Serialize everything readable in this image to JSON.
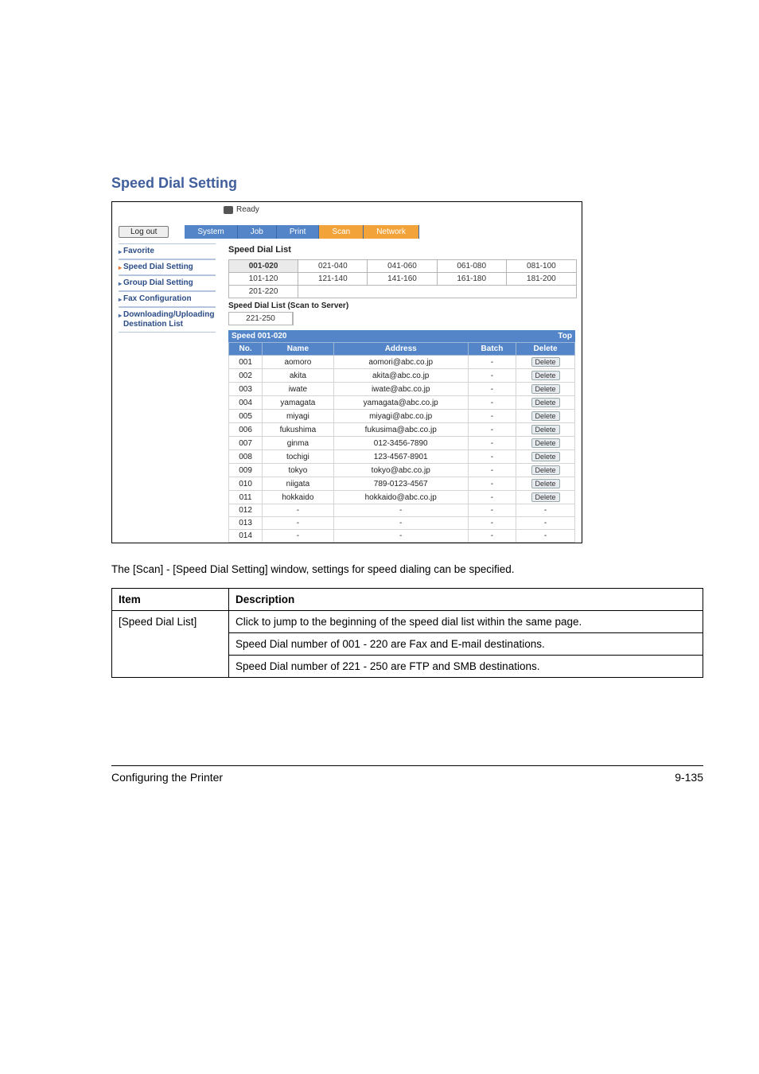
{
  "section_heading": "Speed Dial Setting",
  "screenshot": {
    "ready_status": "Ready",
    "logout_label": "Log out",
    "tabs": {
      "system": "System",
      "job": "Job",
      "print": "Print",
      "scan": "Scan",
      "network": "Network"
    },
    "sidebar": {
      "favorite": "Favorite",
      "speed_dial_setting": "Speed Dial Setting",
      "group_dial_setting": "Group Dial Setting",
      "fax_configuration": "Fax Configuration",
      "download_upload": "Downloading/Uploading Destination List"
    },
    "pane": {
      "title": "Speed Dial List",
      "range_tabs": [
        "001-020",
        "021-040",
        "041-060",
        "061-080",
        "081-100",
        "101-120",
        "121-140",
        "141-160",
        "161-180",
        "181-200",
        "201-220"
      ],
      "subtitle": "Speed Dial List (Scan to Server)",
      "range_tabs2": [
        "221-250"
      ],
      "header_left": "Speed 001-020",
      "header_right": "Top",
      "col_no": "No.",
      "col_name": "Name",
      "col_address": "Address",
      "col_batch": "Batch",
      "col_delete": "Delete",
      "delete_btn": "Delete",
      "rows": [
        {
          "no": "001",
          "name": "aomoro",
          "address": "aomori@abc.co.jp",
          "batch": "-",
          "del": true
        },
        {
          "no": "002",
          "name": "akita",
          "address": "akita@abc.co.jp",
          "batch": "-",
          "del": true
        },
        {
          "no": "003",
          "name": "iwate",
          "address": "iwate@abc.co.jp",
          "batch": "-",
          "del": true
        },
        {
          "no": "004",
          "name": "yamagata",
          "address": "yamagata@abc.co.jp",
          "batch": "-",
          "del": true
        },
        {
          "no": "005",
          "name": "miyagi",
          "address": "miyagi@abc.co.jp",
          "batch": "-",
          "del": true
        },
        {
          "no": "006",
          "name": "fukushima",
          "address": "fukusima@abc.co.jp",
          "batch": "-",
          "del": true
        },
        {
          "no": "007",
          "name": "ginma",
          "address": "012-3456-7890",
          "batch": "-",
          "del": true
        },
        {
          "no": "008",
          "name": "tochigi",
          "address": "123-4567-8901",
          "batch": "-",
          "del": true
        },
        {
          "no": "009",
          "name": "tokyo",
          "address": "tokyo@abc.co.jp",
          "batch": "-",
          "del": true
        },
        {
          "no": "010",
          "name": "niigata",
          "address": "789-0123-4567",
          "batch": "-",
          "del": true
        },
        {
          "no": "011",
          "name": "hokkaido",
          "address": "hokkaido@abc.co.jp",
          "batch": "-",
          "del": true
        },
        {
          "no": "012",
          "name": "-",
          "address": "-",
          "batch": "-",
          "del": false
        },
        {
          "no": "013",
          "name": "-",
          "address": "-",
          "batch": "-",
          "del": false
        },
        {
          "no": "014",
          "name": "-",
          "address": "-",
          "batch": "-",
          "del": false
        }
      ]
    }
  },
  "body_text": "The [Scan] - [Speed Dial Setting] window, settings for speed dialing can be specified.",
  "table": {
    "h_item": "Item",
    "h_desc": "Description",
    "row1_item": "[Speed Dial List]",
    "row1_desc_a": "Click to jump to the beginning of the speed dial list within the same page.",
    "row1_desc_b": "Speed Dial number of 001 - 220 are Fax and E-mail destinations.",
    "row1_desc_c": "Speed Dial number of 221 - 250 are FTP and SMB destinations."
  },
  "footer": {
    "left": "Configuring the Printer",
    "right": "9-135"
  }
}
